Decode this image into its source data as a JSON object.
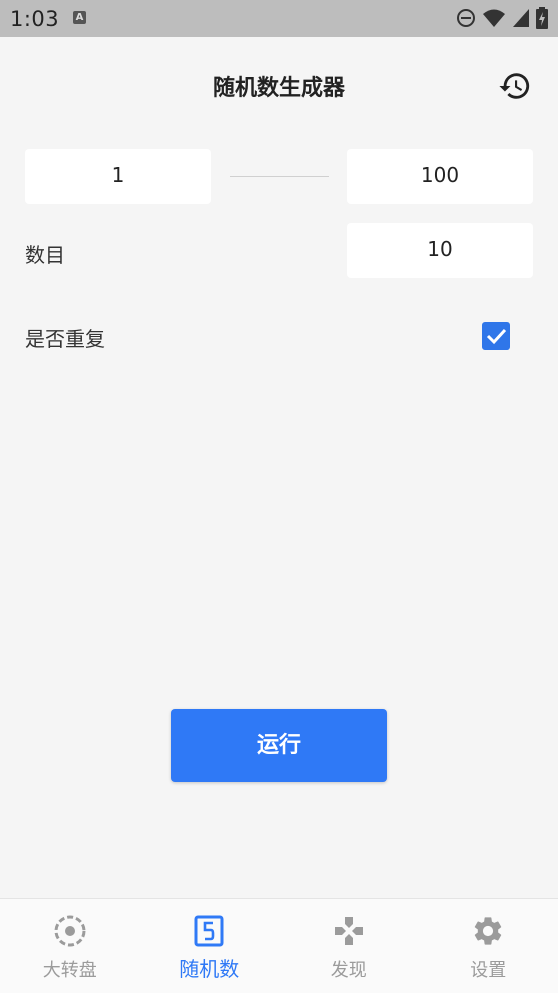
{
  "status_bar": {
    "time": "1:03",
    "badge": "A"
  },
  "header": {
    "title": "随机数生成器"
  },
  "range": {
    "min": "1",
    "max": "100"
  },
  "count": {
    "label": "数目",
    "value": "10"
  },
  "repeat": {
    "label": "是否重复",
    "checked": true
  },
  "actions": {
    "run_label": "运行"
  },
  "bottom_nav": {
    "items": [
      {
        "label": "大转盘",
        "icon": "wheel-icon",
        "active": false
      },
      {
        "label": "随机数",
        "icon": "dice-five-icon",
        "active": true
      },
      {
        "label": "发现",
        "icon": "gamepad-icon",
        "active": false
      },
      {
        "label": "设置",
        "icon": "gear-icon",
        "active": false
      }
    ]
  },
  "colors": {
    "accent": "#2f79f6",
    "background": "#f5f5f5",
    "inactive": "#9b9b9b"
  }
}
